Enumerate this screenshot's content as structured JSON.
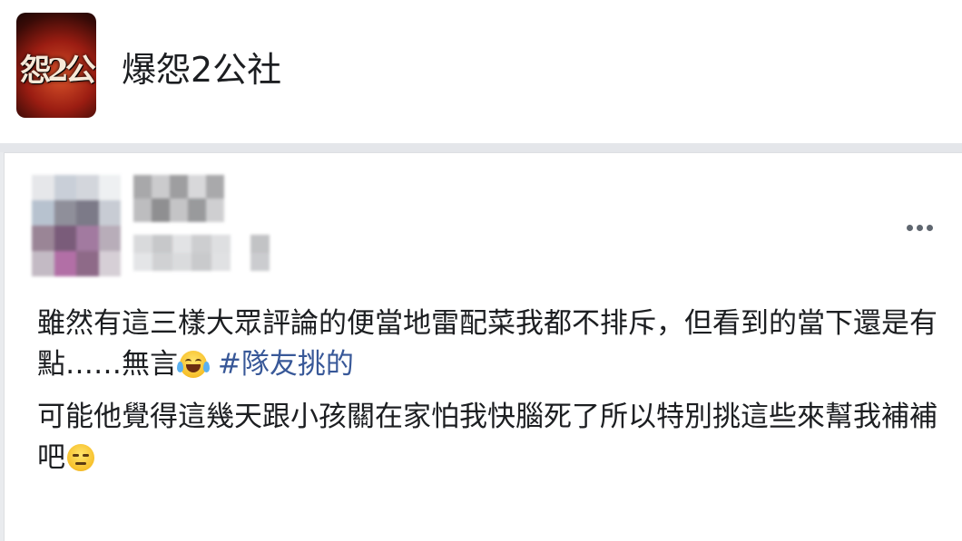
{
  "group": {
    "name": "爆怨2公社",
    "logo_text": "怨2公"
  },
  "post": {
    "more_icon": "more-horizontal-icon",
    "paragraph1": {
      "text": "雖然有這三樣大眾評論的便當地雷配菜我都不排斥，但看到的當下還是有點……無言",
      "emoji": "face-with-tears-of-joy",
      "hashtag": "#隊友挑的"
    },
    "paragraph2": {
      "text": "可能他覺得這幾天跟小孩關在家怕我快腦死了所以特別挑這些來幫我補補吧",
      "emoji": "expressionless-face"
    }
  },
  "colors": {
    "hashtag": "#385898",
    "text": "#1c1e21",
    "background": "#e9ebee"
  }
}
